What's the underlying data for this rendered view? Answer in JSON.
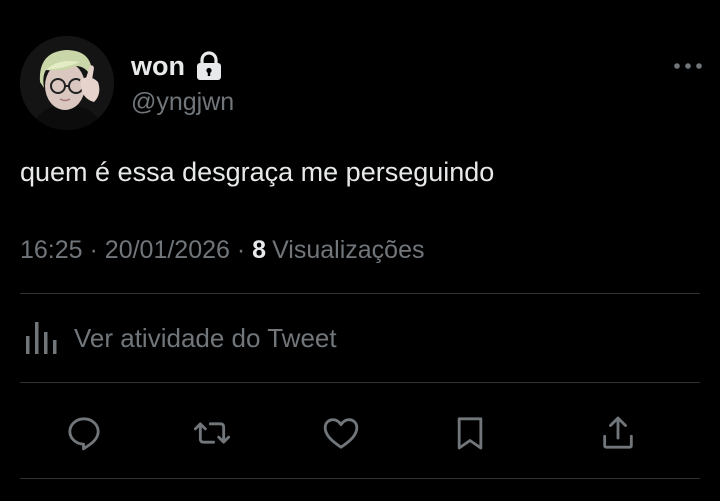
{
  "author": {
    "display_name": "won",
    "handle": "@yngjwn",
    "protected": true
  },
  "tweet": {
    "text": "quem é essa desgraça me perseguindo",
    "time": "16:25",
    "separator": "·",
    "date": "20/01/2026",
    "views_count": "8",
    "views_label": "Visualizações"
  },
  "activity": {
    "label": "Ver atividade do Tweet"
  },
  "actions": {
    "icons": [
      "reply-icon",
      "retweet-icon",
      "like-icon",
      "bookmark-icon",
      "share-icon"
    ]
  },
  "colors": {
    "background": "#000000",
    "primary_text": "#e7e9ea",
    "secondary_text": "#71767b",
    "divider": "#2f3336"
  }
}
